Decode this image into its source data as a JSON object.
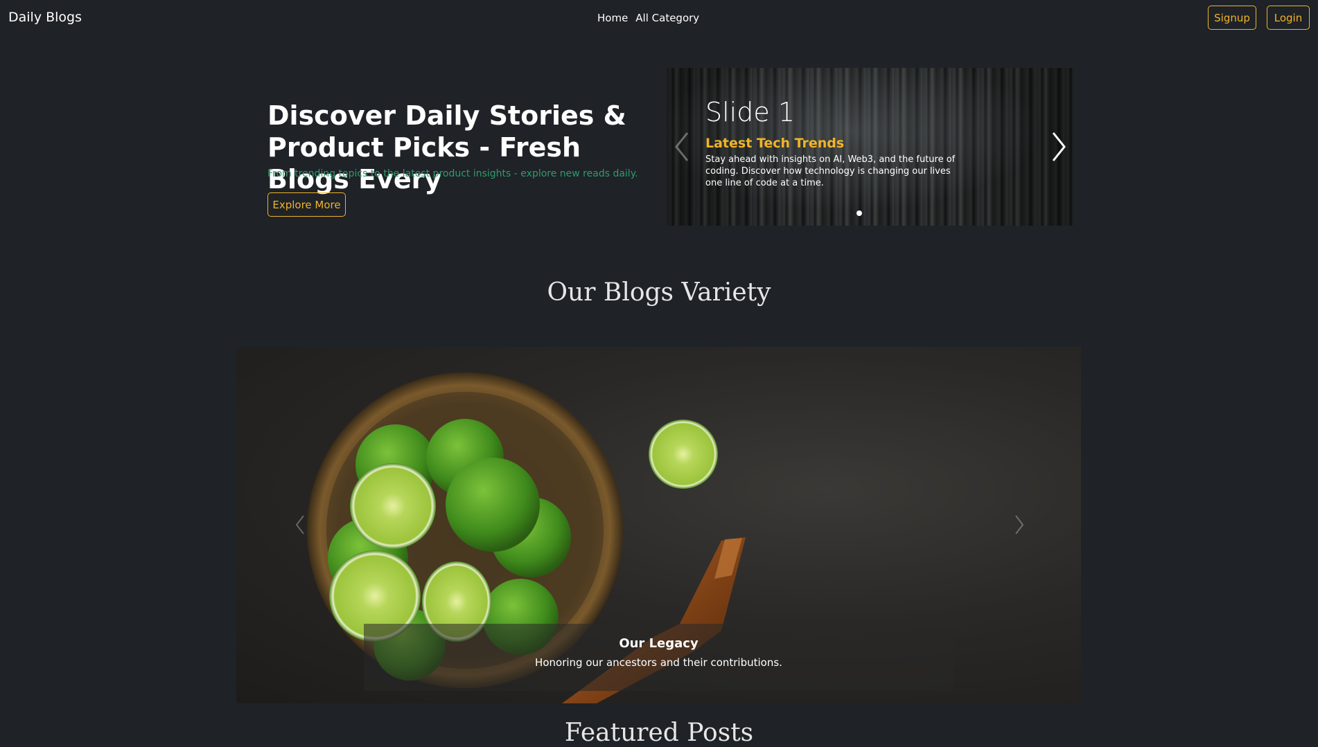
{
  "nav": {
    "brand": "Daily Blogs",
    "links": [
      "Home",
      "All Category"
    ],
    "signup": "Signup",
    "login": "Login"
  },
  "hero": {
    "title": "Discover Daily Stories & Product Picks - Fresh Blogs Every",
    "subtitle": "From trending topics to the latest product insights - explore new reads daily.",
    "cta": "Explore More"
  },
  "hero_carousel": {
    "slide_title": "Slide 1",
    "slide_subtitle": "Latest Tech Trends",
    "slide_text": "Stay ahead with insights on AI, Web3, and the future of coding. Discover how technology is changing our lives one line of code at a time.",
    "active_index": 0
  },
  "sections": {
    "variety": "Our Blogs Variety",
    "featured": "Featured Posts"
  },
  "variety_carousel": {
    "caption_title": "Our Legacy",
    "caption_text": "Honoring our ancestors and their contributions."
  },
  "colors": {
    "background": "#1f2227",
    "accent": "#f0b429",
    "subtitle_green": "#2e9c6a"
  }
}
